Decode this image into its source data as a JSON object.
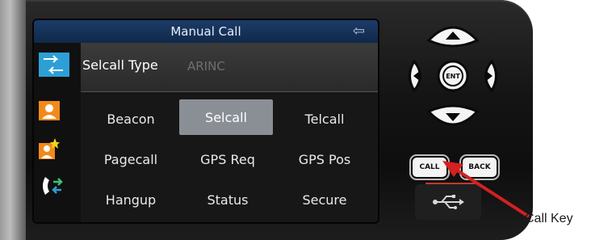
{
  "window": {
    "title": "Manual Call",
    "back_icon": "back-arrow-icon"
  },
  "selcall_type": {
    "label": "Selcall Type",
    "value": "ARINC"
  },
  "call_grid": {
    "rows": [
      [
        "Beacon",
        "Selcall",
        "Telcall"
      ],
      [
        "Pagecall",
        "GPS Req",
        "GPS Pos"
      ],
      [
        "Hangup",
        "Status",
        "Secure"
      ]
    ],
    "selected": "Selcall"
  },
  "hardware_keys": {
    "ent": "ENT",
    "call": "CALL",
    "back": "BACK"
  },
  "annotation": {
    "label": "Call Key"
  },
  "colors": {
    "title_bar": "#1b3b68",
    "selected_cell": "#8a8f96",
    "arrow": "#d42020"
  }
}
